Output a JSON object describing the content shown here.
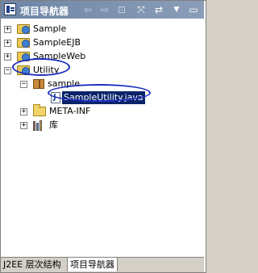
{
  "window": {
    "title": "项目导航器",
    "toolbar": [
      {
        "name": "back-icon",
        "glyph": "⇦"
      },
      {
        "name": "forward-icon",
        "glyph": "⇨"
      },
      {
        "name": "up-icon",
        "glyph": "⊡"
      },
      {
        "name": "collapse-all-icon",
        "glyph": "⤧"
      },
      {
        "name": "link-with-editor-icon",
        "glyph": "⇄"
      },
      {
        "name": "view-menu-icon",
        "glyph": "▼"
      },
      {
        "name": "maximize-icon",
        "glyph": "▭"
      }
    ]
  },
  "tree": {
    "items": [
      {
        "label": "Sample",
        "expander": "+"
      },
      {
        "label": "SampleEJB",
        "expander": "+"
      },
      {
        "label": "SampleWeb",
        "expander": "+"
      },
      {
        "label": "Utility",
        "expander": "−"
      },
      {
        "label": "sample",
        "expander": "−"
      },
      {
        "label": "SampleUtility.java"
      },
      {
        "label": "META-INF",
        "expander": "+"
      },
      {
        "label": "库",
        "expander": "+"
      }
    ]
  },
  "tabs": [
    {
      "label": "J2EE 层次结构"
    },
    {
      "label": "项目导航器"
    }
  ],
  "colors": {
    "titlebar": "#6e86a6",
    "selection": "#0a246a",
    "annotation": "#1f2fbf"
  }
}
